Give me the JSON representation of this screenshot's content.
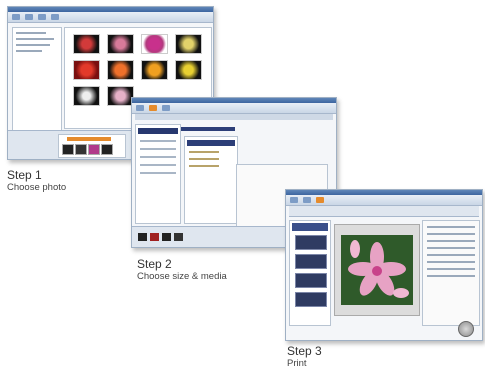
{
  "steps": [
    {
      "title": "Step 1",
      "subtitle": "Choose photo"
    },
    {
      "title": "Step 2",
      "subtitle": "Choose size & media"
    },
    {
      "title": "Step 3",
      "subtitle": "Print"
    }
  ],
  "colors": {
    "window_title": "#3c65a0",
    "selection": "#2c3e78",
    "accent": "#e58b2c"
  },
  "icons": [
    "print-icon",
    "flower-thumbnail",
    "folder-tree-icon"
  ]
}
